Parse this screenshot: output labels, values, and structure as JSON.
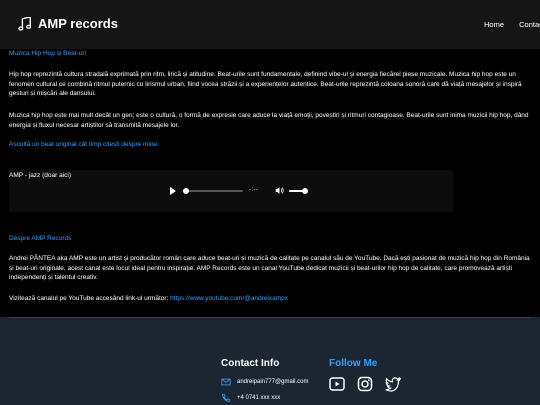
{
  "header": {
    "logo_text": "AMP records",
    "logo_icon": "music-note-icon",
    "nav": [
      "Home",
      "Contact"
    ]
  },
  "section1": {
    "title": "Muzica Hip Hop și Beat-uri",
    "p1": "Hip hop reprezintă cultura stradală exprimată prin ritm, lirică și atitudine. Beat-urile sunt fundamentale, definind vibe-ul și energia fiecărei piese muzicale. Muzica hip hop este un fenomen cultural ce combină ritmul puternic cu lirismul urban, fiind vocea străzii și a experiențelor autentice. Beat-urile reprezintă coloana sonoră care dă viață mesajelor și inspiră gesturi și mișcări ale dansului.",
    "p2": "Muzica hip hop este mai mult decât un gen; este o cultură, o formă de expresie care aduce la viață emoții, povestiri și ritmuri contagioase. Beat-urile sunt inima muzicii hip hop, dând energia și fluxul necesar artiștilor să transmită mesajele lor.",
    "listen_prompt": "Ascultă un beat original cât timp citești despre mine:"
  },
  "audio": {
    "label": "AMP - jazz (doar aici)",
    "time": "-:--",
    "progress": 0,
    "volume": 1
  },
  "section2": {
    "title": "Despre AMP Records",
    "p1": "Andrei PÂNTEA aka AMP este un artist și producător român care aduce beat-uri și muzică de calitate pe canalul său de YouTube. Dacă ești pasionat de muzică hip hop din România și beat-uri originale, acest canal este locul ideal pentru inspirație. AMP Records este un canal YouTube dedicat muzicii și beat-urilor hip hop de calitate, care promovează artiști independenți și talentul creativ.",
    "visit_text": "Vizitează canalul pe YouTube accesând link-ul următor: ",
    "visit_link": "https://www.youtube.com/@andreixampx"
  },
  "footer": {
    "contact_heading": "Contact Info",
    "follow_heading": "Follow Me",
    "email": "andreipain777@gmail.com",
    "phone": "+4 0741 xxx xxx",
    "social_icons": [
      "youtube-icon",
      "instagram-icon",
      "twitter-icon"
    ]
  },
  "colors": {
    "accent": "#3a9df8",
    "header_bg": "#151515",
    "footer_bg": "#1c2633"
  }
}
